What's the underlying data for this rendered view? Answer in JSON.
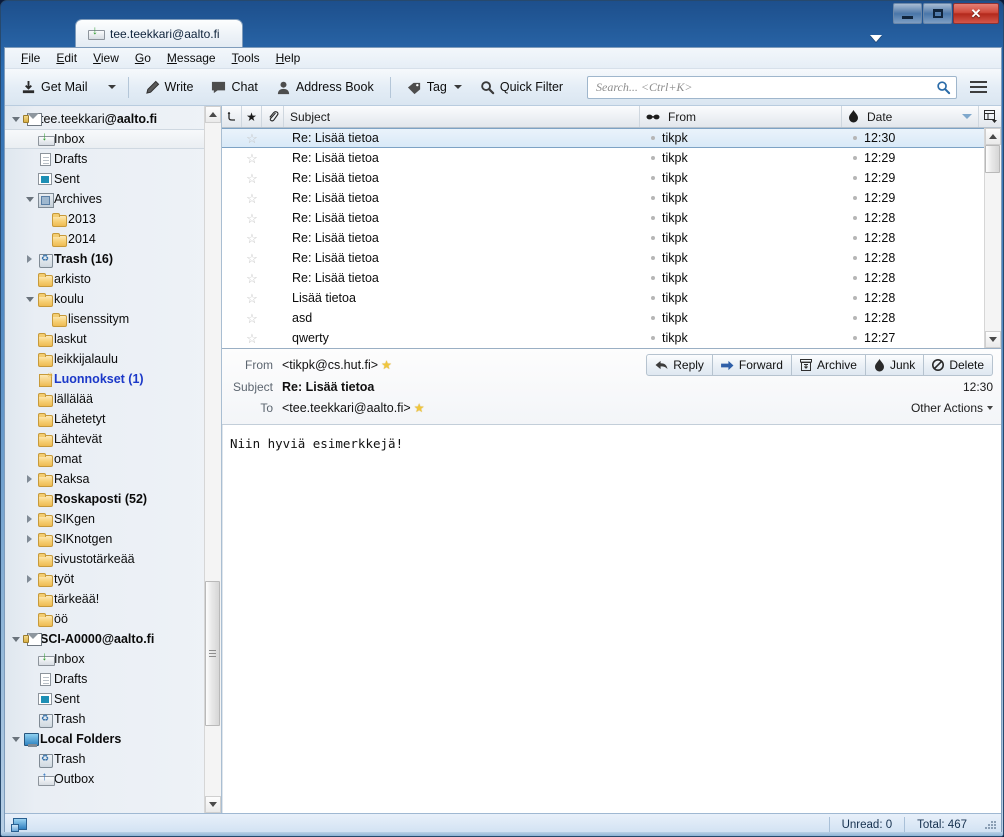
{
  "window": {
    "tab_title": "tee.teekkari@aalto.fi",
    "tab_icon": "inbox-icon",
    "minimize_label": "–",
    "maximize_label": "□",
    "close_label": "✕"
  },
  "menubar": [
    {
      "label": "File",
      "accel": "F"
    },
    {
      "label": "Edit",
      "accel": "E"
    },
    {
      "label": "View",
      "accel": "V"
    },
    {
      "label": "Go",
      "accel": "G"
    },
    {
      "label": "Message",
      "accel": "M"
    },
    {
      "label": "Tools",
      "accel": "T"
    },
    {
      "label": "Help",
      "accel": "H"
    }
  ],
  "toolbar": {
    "get_mail": "Get Mail",
    "write": "Write",
    "chat": "Chat",
    "address_book": "Address Book",
    "tag": "Tag",
    "quick_filter": "Quick Filter"
  },
  "search": {
    "placeholder": "Search... <Ctrl+K>",
    "icon": "search-icon"
  },
  "folder_pane": {
    "items": [
      {
        "label": "tee.teekkari",
        "label_bold": "@aalto.fi",
        "icon": "account-icon",
        "indent": 0,
        "twisty": "open",
        "style": "account",
        "selected": false
      },
      {
        "label": "Inbox",
        "icon": "inbox-icon",
        "indent": 1,
        "twisty": "none",
        "style": "normal",
        "selected": true
      },
      {
        "label": "Drafts",
        "icon": "draft-icon",
        "indent": 1,
        "twisty": "none",
        "style": "normal",
        "selected": false
      },
      {
        "label": "Sent",
        "icon": "sent-icon",
        "indent": 1,
        "twisty": "none",
        "style": "normal",
        "selected": false
      },
      {
        "label": "Archives",
        "icon": "archive-icon",
        "indent": 1,
        "twisty": "open",
        "style": "normal",
        "selected": false
      },
      {
        "label": "2013",
        "icon": "folder-icon",
        "indent": 2,
        "twisty": "none",
        "style": "normal",
        "selected": false
      },
      {
        "label": "2014",
        "icon": "folder-icon",
        "indent": 2,
        "twisty": "none",
        "style": "normal",
        "selected": false
      },
      {
        "label": "Trash (16)",
        "icon": "trash-icon",
        "indent": 1,
        "twisty": "closed",
        "style": "bold",
        "selected": false
      },
      {
        "label": "arkisto",
        "icon": "folder-icon",
        "indent": 1,
        "twisty": "none",
        "style": "normal",
        "selected": false
      },
      {
        "label": "koulu",
        "icon": "folder-icon",
        "indent": 1,
        "twisty": "open",
        "style": "normal",
        "selected": false
      },
      {
        "label": "lisenssitym",
        "icon": "folder-icon",
        "indent": 2,
        "twisty": "none",
        "style": "normal",
        "selected": false
      },
      {
        "label": "laskut",
        "icon": "folder-icon",
        "indent": 1,
        "twisty": "none",
        "style": "normal",
        "selected": false
      },
      {
        "label": "leikkijalaulu",
        "icon": "folder-icon",
        "indent": 1,
        "twisty": "none",
        "style": "normal",
        "selected": false
      },
      {
        "label": "Luonnokset (1)",
        "icon": "draft-folder-icon",
        "indent": 1,
        "twisty": "none",
        "style": "blue",
        "selected": false
      },
      {
        "label": "lällälää",
        "icon": "folder-icon",
        "indent": 1,
        "twisty": "none",
        "style": "normal",
        "selected": false
      },
      {
        "label": "Lähetetyt",
        "icon": "folder-icon",
        "indent": 1,
        "twisty": "none",
        "style": "normal",
        "selected": false
      },
      {
        "label": "Lähtevät",
        "icon": "folder-icon",
        "indent": 1,
        "twisty": "none",
        "style": "normal",
        "selected": false
      },
      {
        "label": "omat",
        "icon": "folder-icon",
        "indent": 1,
        "twisty": "none",
        "style": "normal",
        "selected": false
      },
      {
        "label": "Raksa",
        "icon": "folder-icon",
        "indent": 1,
        "twisty": "closed",
        "style": "normal",
        "selected": false
      },
      {
        "label": "Roskaposti (52)",
        "icon": "folder-icon",
        "indent": 1,
        "twisty": "none",
        "style": "bold",
        "selected": false
      },
      {
        "label": "SIKgen",
        "icon": "folder-icon",
        "indent": 1,
        "twisty": "closed",
        "style": "normal",
        "selected": false
      },
      {
        "label": "SIKnotgen",
        "icon": "folder-icon",
        "indent": 1,
        "twisty": "closed",
        "style": "normal",
        "selected": false
      },
      {
        "label": "sivustotärkeää",
        "icon": "folder-icon",
        "indent": 1,
        "twisty": "none",
        "style": "normal",
        "selected": false
      },
      {
        "label": "työt",
        "icon": "folder-icon",
        "indent": 1,
        "twisty": "closed",
        "style": "normal",
        "selected": false
      },
      {
        "label": "tärkeää!",
        "icon": "folder-icon",
        "indent": 1,
        "twisty": "none",
        "style": "normal",
        "selected": false
      },
      {
        "label": "öö",
        "icon": "folder-icon",
        "indent": 1,
        "twisty": "none",
        "style": "normal",
        "selected": false
      },
      {
        "label": "SCI-A0000@aalto.fi",
        "icon": "account-icon",
        "indent": 0,
        "twisty": "open",
        "style": "bold",
        "selected": false
      },
      {
        "label": "Inbox",
        "icon": "inbox-icon",
        "indent": 1,
        "twisty": "none",
        "style": "normal",
        "selected": false
      },
      {
        "label": "Drafts",
        "icon": "draft-icon",
        "indent": 1,
        "twisty": "none",
        "style": "normal",
        "selected": false
      },
      {
        "label": "Sent",
        "icon": "sent-icon",
        "indent": 1,
        "twisty": "none",
        "style": "normal",
        "selected": false
      },
      {
        "label": "Trash",
        "icon": "trash-icon",
        "indent": 1,
        "twisty": "none",
        "style": "normal",
        "selected": false
      },
      {
        "label": "Local Folders",
        "icon": "local-folders-icon",
        "indent": 0,
        "twisty": "open",
        "style": "bold",
        "selected": false
      },
      {
        "label": "Trash",
        "icon": "trash-icon",
        "indent": 1,
        "twisty": "none",
        "style": "normal",
        "selected": false
      },
      {
        "label": "Outbox",
        "icon": "outbox-icon",
        "indent": 1,
        "twisty": "none",
        "style": "normal",
        "selected": false
      }
    ]
  },
  "message_list": {
    "columns": {
      "thread": "thread-column-icon",
      "star": "star-column-icon",
      "attachment": "attachment-column-icon",
      "subject": "Subject",
      "read": "read-column-icon",
      "from": "From",
      "junk": "junk-column-icon",
      "date": "Date",
      "picker": "column-picker-icon"
    },
    "sort": {
      "column": "Date",
      "direction": "descending"
    },
    "rows": [
      {
        "subject": "Re: Lisää tietoa",
        "from": "tikpk",
        "date": "12:30",
        "selected": true
      },
      {
        "subject": "Re: Lisää tietoa",
        "from": "tikpk",
        "date": "12:29",
        "selected": false
      },
      {
        "subject": "Re: Lisää tietoa",
        "from": "tikpk",
        "date": "12:29",
        "selected": false
      },
      {
        "subject": "Re: Lisää tietoa",
        "from": "tikpk",
        "date": "12:29",
        "selected": false
      },
      {
        "subject": "Re: Lisää tietoa",
        "from": "tikpk",
        "date": "12:28",
        "selected": false
      },
      {
        "subject": "Re: Lisää tietoa",
        "from": "tikpk",
        "date": "12:28",
        "selected": false
      },
      {
        "subject": "Re: Lisää tietoa",
        "from": "tikpk",
        "date": "12:28",
        "selected": false
      },
      {
        "subject": "Re: Lisää tietoa",
        "from": "tikpk",
        "date": "12:28",
        "selected": false
      },
      {
        "subject": "Lisää tietoa",
        "from": "tikpk",
        "date": "12:28",
        "selected": false
      },
      {
        "subject": "asd",
        "from": "tikpk",
        "date": "12:28",
        "selected": false
      },
      {
        "subject": "qwerty",
        "from": "tikpk",
        "date": "12:27",
        "selected": false
      }
    ]
  },
  "message_header": {
    "from_label": "From",
    "from_value": "<tikpk@cs.hut.fi>",
    "subject_label": "Subject",
    "subject_value": "Re: Lisää tietoa",
    "to_label": "To",
    "to_value": "<tee.teekkari@aalto.fi>",
    "time": "12:30",
    "other_actions": "Other Actions",
    "actions": [
      {
        "label": "Reply",
        "icon": "reply-arrow-icon"
      },
      {
        "label": "Forward",
        "icon": "forward-arrow-icon"
      },
      {
        "label": "Archive",
        "icon": "archive-icon"
      },
      {
        "label": "Junk",
        "icon": "junk-flame-icon"
      },
      {
        "label": "Delete",
        "icon": "delete-icon"
      }
    ]
  },
  "message_body": {
    "text": "Niin hyviä esimerkkejä!"
  },
  "statusbar": {
    "icon": "connection-icon",
    "unread": "Unread: 0",
    "total": "Total: 467"
  },
  "colors": {
    "selection_blue": "#d9e9f7",
    "link_blue": "#1b38c8",
    "star_yellow": "#f0c63c",
    "close_red": "#b3291c"
  }
}
